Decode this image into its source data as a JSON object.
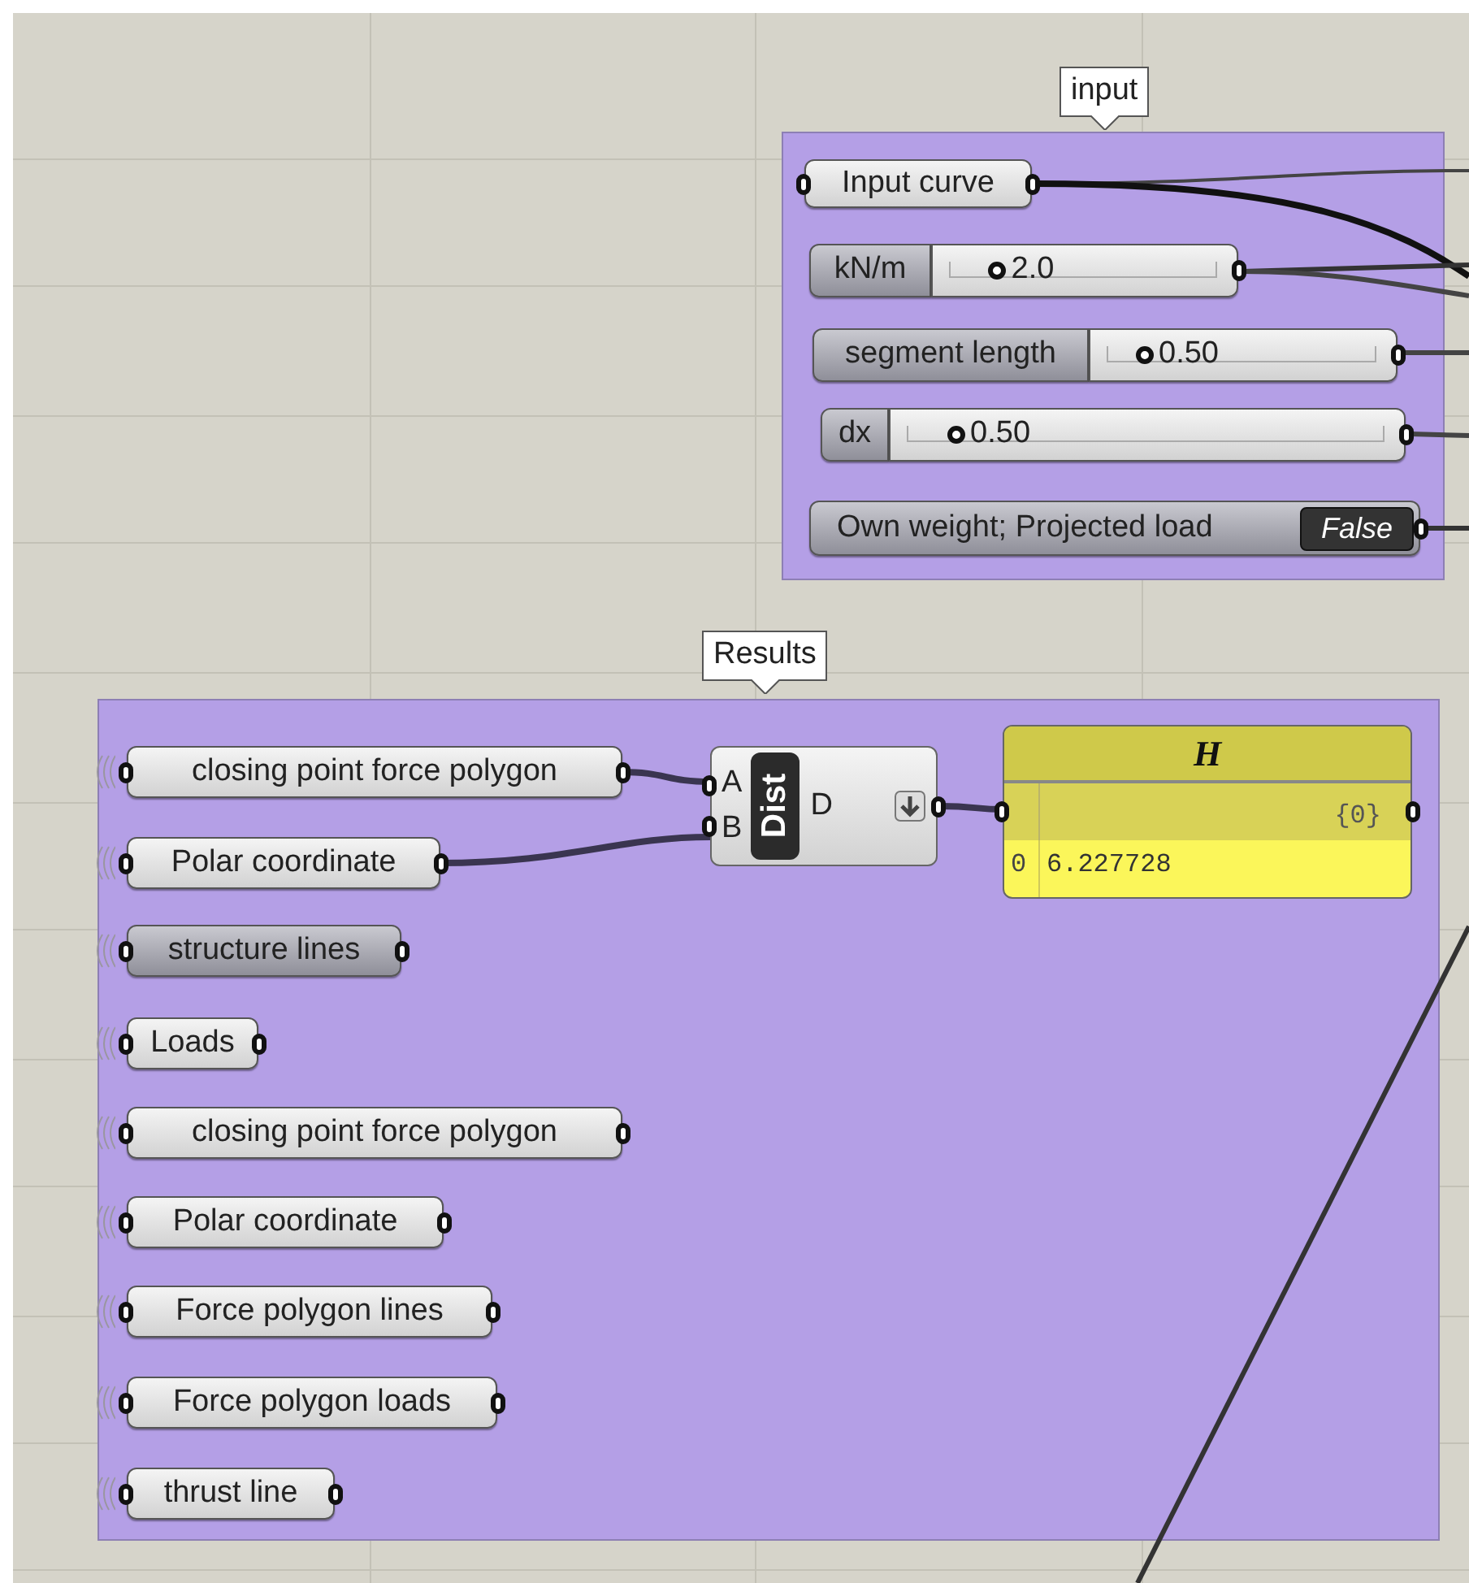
{
  "canvas": {
    "input_group": {
      "label": "input",
      "params": [
        {
          "kind": "param",
          "label": "Input curve"
        },
        {
          "kind": "slider",
          "label": "kN/m",
          "value": "2.0",
          "level": 0.14
        },
        {
          "kind": "slider",
          "label": "segment length",
          "value": "0.50",
          "level": 0.1
        },
        {
          "kind": "slider",
          "label": "dx",
          "value": "0.50",
          "level": 0.08
        },
        {
          "kind": "toggle",
          "label": "Own weight; Projected load",
          "value": "False"
        }
      ]
    },
    "results_group": {
      "label": "Results",
      "params": [
        {
          "label": "closing point force polygon",
          "disabled": false
        },
        {
          "label": "Polar coordinate",
          "disabled": false
        },
        {
          "label": "structure lines",
          "disabled": true
        },
        {
          "label": "Loads",
          "disabled": false
        },
        {
          "label": "closing point force polygon",
          "disabled": false
        },
        {
          "label": "Polar coordinate",
          "disabled": false
        },
        {
          "label": "Force polygon lines",
          "disabled": false
        },
        {
          "label": "Force polygon loads",
          "disabled": false
        },
        {
          "label": "thrust line",
          "disabled": false
        }
      ]
    },
    "component": {
      "name": "Dist",
      "inputs": [
        "A",
        "B"
      ],
      "outputs": [
        "D"
      ]
    },
    "panel": {
      "title": "H",
      "path": "{0}",
      "rows": [
        {
          "index": "0",
          "value": "6.227728"
        }
      ]
    }
  }
}
